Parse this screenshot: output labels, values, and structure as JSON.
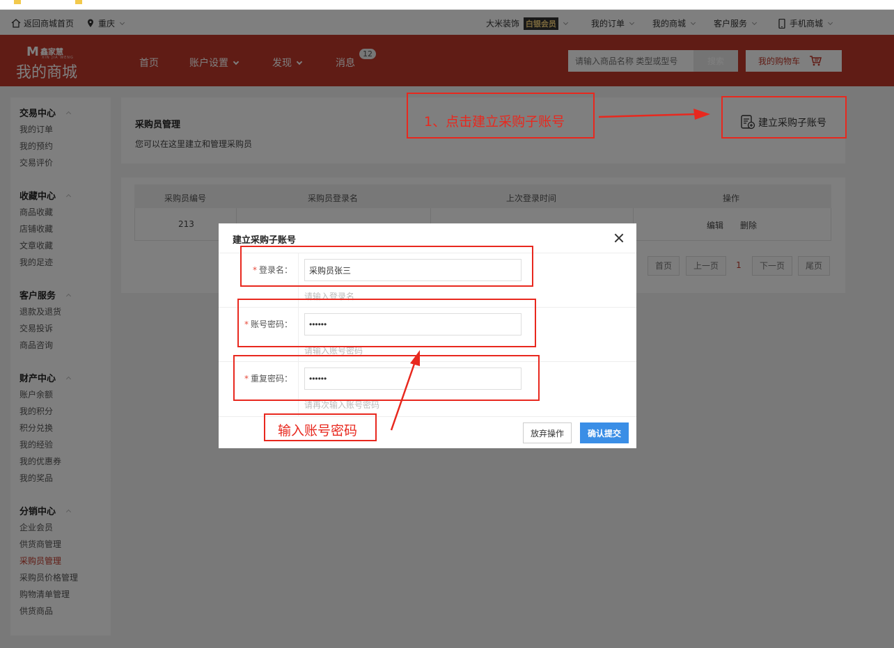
{
  "topbar": {
    "home": "返回商城首页",
    "city": "重庆",
    "shop_name": "大米装饰",
    "member_level": "白银会员",
    "orders": "我的订单",
    "my_mall": "我的商城",
    "service": "客户服务",
    "mobile": "手机商城"
  },
  "header": {
    "logo_mark": "M",
    "logo_brand": "鑫家慧",
    "logo_pinyin": "XIN JIA WENG",
    "logo_title": "我的商城",
    "nav": [
      "首页",
      "账户设置",
      "发现",
      "消息"
    ],
    "message_count": "12",
    "search_placeholder": "请输入商品名称 类型或型号",
    "search_button": "搜索",
    "cart_button": "我的购物车"
  },
  "sidebar": {
    "groups": [
      {
        "title": "交易中心",
        "items": [
          "我的订单",
          "我的预约",
          "交易评价"
        ]
      },
      {
        "title": "收藏中心",
        "items": [
          "商品收藏",
          "店铺收藏",
          "文章收藏",
          "我的足迹"
        ]
      },
      {
        "title": "客户服务",
        "items": [
          "退款及退货",
          "交易投诉",
          "商品咨询"
        ]
      },
      {
        "title": "财产中心",
        "items": [
          "账户余额",
          "我的积分",
          "积分兑换",
          "我的经验",
          "我的优惠券",
          "我的奖品"
        ]
      },
      {
        "title": "分销中心",
        "items": [
          "企业会员",
          "供货商管理",
          "采购员管理",
          "采购员价格管理",
          "购物清单管理",
          "供货商品"
        ]
      }
    ],
    "active_item": "采购员管理"
  },
  "main": {
    "title": "采购员管理",
    "description": "您可以在这里建立和管理采购员",
    "create_button": "建立采购子账号",
    "table": {
      "headers": [
        "采购员编号",
        "采购员登录名",
        "上次登录时间",
        "操作"
      ],
      "rows": [
        {
          "id": "213",
          "edit": "编辑",
          "delete": "删除"
        }
      ]
    },
    "pagination": [
      "首页",
      "上一页",
      "1",
      "下一页",
      "尾页"
    ]
  },
  "modal": {
    "title": "建立采购子账号",
    "fields": [
      {
        "label": "登录名：",
        "value": "采购员张三",
        "hint": "请输入登录名"
      },
      {
        "label": "账号密码：",
        "value": "••••••",
        "hint": "请输入账号密码"
      },
      {
        "label": "重复密码：",
        "value": "••••••",
        "hint": "请再次输入账号密码"
      }
    ],
    "required_mark": "*",
    "cancel_button": "放弃操作",
    "submit_button": "确认提交"
  },
  "annotations": {
    "step1": "1、点击建立采购子账号",
    "step2": "输入账号密码",
    "color": "#e8281e"
  },
  "colors": {
    "brand_red": "#c0392b",
    "primary_blue": "#3a8ee6"
  }
}
